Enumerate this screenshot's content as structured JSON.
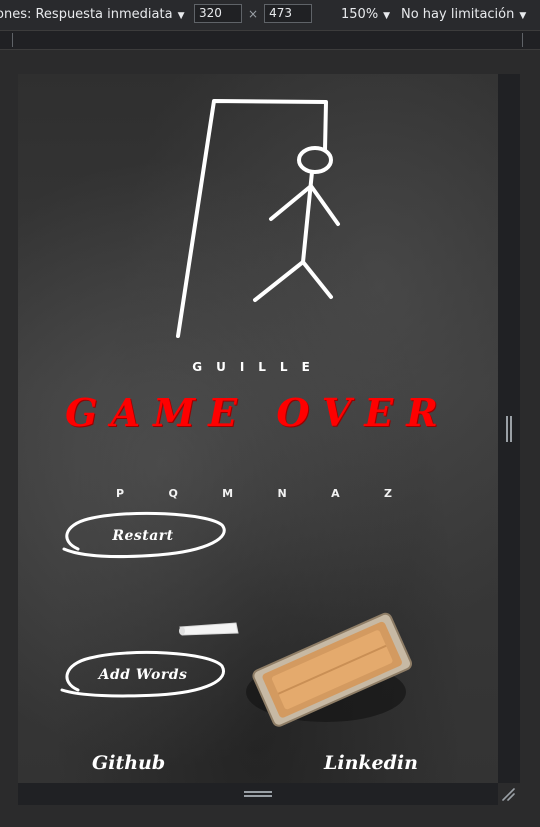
{
  "devtools": {
    "mode_label": "ones: Respuesta inmediata",
    "width_value": "320",
    "height_value": "473",
    "times_symbol": "×",
    "zoom": "150%",
    "throttle": "No hay limitación",
    "caret": "▼"
  },
  "game": {
    "player_name": "GUILLE",
    "status_title": "GAME OVER",
    "letters": [
      "P",
      "Q",
      "M",
      "N",
      "A",
      "Z"
    ],
    "restart_label": "Restart",
    "add_words_label": "Add Words",
    "footer": {
      "github": "Github",
      "linkedin": "Linkedin"
    }
  },
  "colors": {
    "status_red": "#ff0000",
    "chalk_white": "#ffffff",
    "board": "#3a3a3a"
  }
}
